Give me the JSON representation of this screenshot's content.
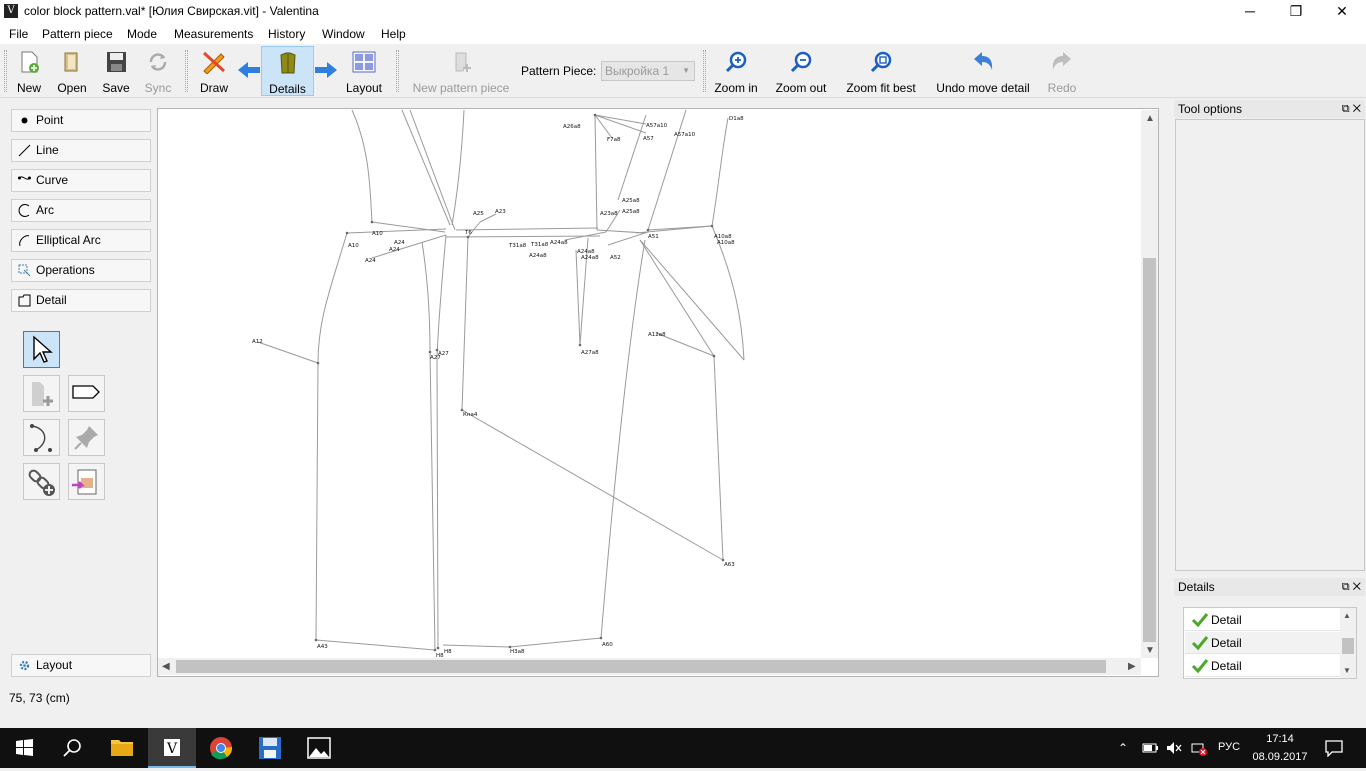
{
  "window": {
    "title": "color block pattern.val* [Юлия Свирская.vit] - Valentina",
    "app_icon": "V",
    "controls": {
      "minimize": "─",
      "maximize": "❐",
      "close": "✕"
    }
  },
  "menu": [
    "File",
    "Pattern piece",
    "Mode",
    "Measurements",
    "History",
    "Window",
    "Help"
  ],
  "toolbar": {
    "new": "New",
    "open": "Open",
    "save": "Save",
    "sync": "Sync",
    "draw": "Draw",
    "details": "Details",
    "layout": "Layout",
    "new_pattern_piece": "New pattern piece",
    "pattern_piece_label": "Pattern Piece:",
    "pattern_piece_value": "Выкройка 1",
    "zoom_in": "Zoom in",
    "zoom_out": "Zoom out",
    "zoom_fit": "Zoom fit best",
    "undo": "Undo move detail",
    "redo": "Redo"
  },
  "tool_groups": [
    "Point",
    "Line",
    "Curve",
    "Arc",
    "Elliptical Arc",
    "Operations",
    "Detail"
  ],
  "layout_group": "Layout",
  "docks": {
    "tool_options": "Tool options",
    "details": "Details",
    "details_items": [
      "Detail",
      "Detail",
      "Detail"
    ]
  },
  "status": "75, 73 (cm)",
  "pattern_labels": {
    "a26a8": "A26a8",
    "a57a10a": "A57a10",
    "a57": "A57",
    "a57a10b": "A57a10",
    "f7a8": "F7a8",
    "d1a8": "D1a8",
    "a25a8a": "A25a8",
    "a25a8b": "A25a8",
    "a23a8": "A23a8",
    "a25": "A25",
    "a23": "A23",
    "t6": "T6",
    "a10": "A10",
    "a10b": "A10",
    "a24": "A24",
    "a24b": "A24",
    "a24c": "A24",
    "t31a8": "T31a8",
    "t31a8b": "T31a8",
    "a24a8": "A24a8",
    "a24a8b": "A24a8",
    "a24a8c": "A24a8",
    "a24a8d": "A24a8",
    "a51": "A51",
    "a52": "A52",
    "a10a8": "A10a8",
    "a10a8b": "A10a8",
    "a12": "A12",
    "a27": "A27",
    "a27b": "A27",
    "a27a8": "A27a8",
    "a12a8": "A12a8",
    "kha4": "Кнa4",
    "a63": "A63",
    "a43": "A43",
    "h8": "H8",
    "h8b": "H8",
    "h3a8": "H3a8",
    "a60": "A60"
  },
  "taskbar": {
    "lang": "РУС",
    "time": "17:14",
    "date": "08.09.2017"
  },
  "colors": {
    "accent": "#3c7fb1",
    "selection": "#cce4f7",
    "check": "#4ca82c"
  }
}
